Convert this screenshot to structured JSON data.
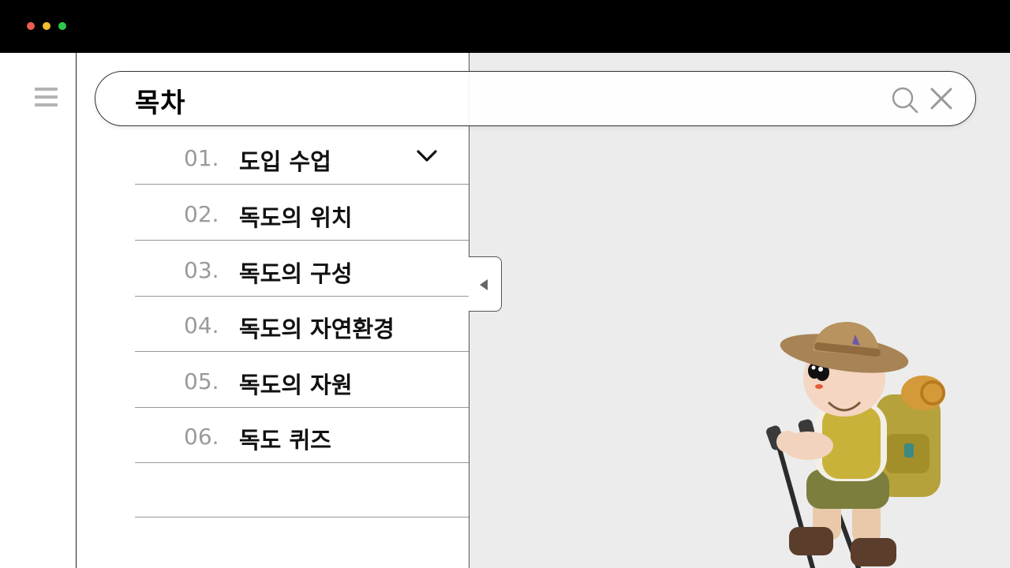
{
  "window": {
    "controls": [
      "close",
      "minimize",
      "maximize"
    ],
    "control_colors": [
      "#ee5d52",
      "#f4bd2f",
      "#2fc94a"
    ]
  },
  "sidebar": {
    "menu_icon": "hamburger-menu-icon"
  },
  "search": {
    "title": "목차",
    "search_icon": "search-icon",
    "close_icon": "close-icon"
  },
  "toc": {
    "items": [
      {
        "num": "01.",
        "label": "도입 수업",
        "expanded": true
      },
      {
        "num": "02.",
        "label": "독도의 위치"
      },
      {
        "num": "03.",
        "label": "독도의 구성"
      },
      {
        "num": "04.",
        "label": "독도의 자연환경"
      },
      {
        "num": "05.",
        "label": "독도의 자원"
      },
      {
        "num": "06.",
        "label": "독도 퀴즈"
      }
    ]
  },
  "panel": {
    "collapse_icon": "caret-left-icon"
  },
  "illustration": {
    "name": "hiker-character-illustration"
  }
}
